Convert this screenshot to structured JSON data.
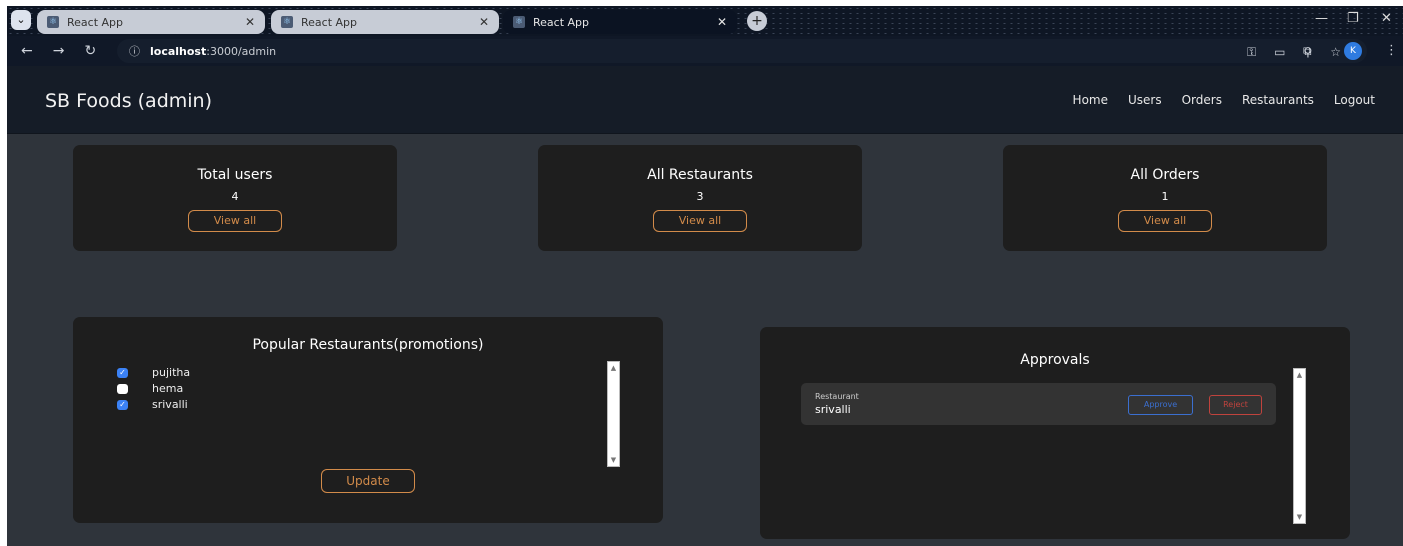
{
  "browser": {
    "tabs": [
      {
        "label": "React App",
        "active": false
      },
      {
        "label": "React App",
        "active": false
      },
      {
        "label": "React App",
        "active": true
      }
    ],
    "url_host": "localhost",
    "url_path": ":3000/admin",
    "profile_initial": "K"
  },
  "header": {
    "brand": "SB Foods (admin)",
    "nav": [
      "Home",
      "Users",
      "Orders",
      "Restaurants",
      "Logout"
    ]
  },
  "stats": [
    {
      "title": "Total users",
      "count": "4",
      "button": "View all"
    },
    {
      "title": "All Restaurants",
      "count": "3",
      "button": "View all"
    },
    {
      "title": "All Orders",
      "count": "1",
      "button": "View all"
    }
  ],
  "popular": {
    "title": "Popular Restaurants(promotions)",
    "items": [
      {
        "name": "pujitha",
        "checked": true
      },
      {
        "name": "hema",
        "checked": false
      },
      {
        "name": "srivalli",
        "checked": true
      }
    ],
    "button": "Update"
  },
  "approvals": {
    "title": "Approvals",
    "item_label": "Restaurant",
    "item_name": "srivalli",
    "approve": "Approve",
    "reject": "Reject"
  },
  "colors": {
    "accent": "#d28b4a",
    "checkbox": "#3b82f6",
    "approve": "#3b6fd0",
    "reject": "#c0433d"
  }
}
